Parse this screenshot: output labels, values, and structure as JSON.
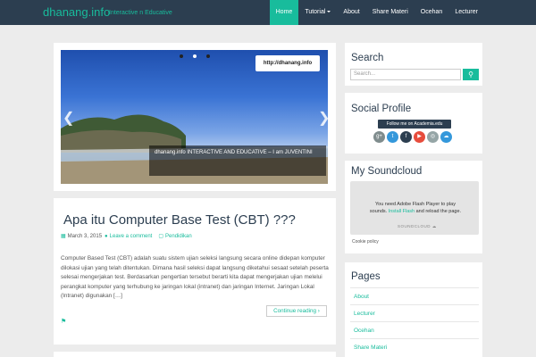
{
  "header": {
    "brand": "dhanang.info",
    "tagline": "Interactive n Educative",
    "nav": [
      {
        "label": "Home",
        "active": true
      },
      {
        "label": "Tutorial",
        "dropdown": true
      },
      {
        "label": "About"
      },
      {
        "label": "Share Materi"
      },
      {
        "label": "Ocehan"
      },
      {
        "label": "Lecturer"
      }
    ]
  },
  "slider": {
    "url_label": "http://dhanang.info",
    "caption": "dhanang.info INTERACTIVE AND EDUCATIVE – I am JUVENTINI",
    "prev_icon": "chevron-left-icon",
    "next_icon": "chevron-right-icon",
    "dots": [
      false,
      true,
      false
    ]
  },
  "post": {
    "title": "Apa itu Computer Base Test (CBT) ???",
    "date": "March 3, 2015",
    "comments": "Leave a comment",
    "category": "Pendidikan",
    "excerpt": "Computer Based Test (CBT) adalah suatu sistem ujian seleksi langsung secara online didepan komputer dilokasi ujian yang telah ditentukan. Dimana hasil seleksi dapat langsung diketahui sesaat setelah peserta selesai mengerjakan test. Berdasarkan pengertian tersebut berarti kita dapat mengerjakan ujian melelui perangkat komputer yang terhubung ke jaringan lokal (intranet) dan jaringan Internet. Jaringan Lokal (Intranet) digunakan […]",
    "continue": "Continue reading"
  },
  "sidebar": {
    "search": {
      "title": "Search",
      "placeholder": "Search..."
    },
    "social": {
      "title": "Social Profile",
      "academia": "Follow me on Academia.edu",
      "icons": [
        {
          "name": "google-plus-icon",
          "color": "#7f8c8d",
          "glyph": "g+"
        },
        {
          "name": "twitter-icon",
          "color": "#3498db",
          "glyph": "t"
        },
        {
          "name": "facebook-icon",
          "color": "#2c3e50",
          "glyph": "f"
        },
        {
          "name": "youtube-icon",
          "color": "#e74c3c",
          "glyph": "▶"
        },
        {
          "name": "instagram-icon",
          "color": "#95a5a6",
          "glyph": "◎"
        },
        {
          "name": "soundcloud-icon",
          "color": "#3498db",
          "glyph": "☁"
        }
      ]
    },
    "soundcloud": {
      "title": "My Soundcloud",
      "line1": "You need Adobe Flash Player to play sounds.",
      "install": "Install Flash",
      "line2": "and reload the page.",
      "logo": "SOUNDCLOUD",
      "cookie": "Cookie policy"
    },
    "pages": {
      "title": "Pages",
      "items": [
        "About",
        "Lecturer",
        "Ocehan",
        "Share Materi"
      ]
    }
  },
  "colors": {
    "accent": "#18bc9c",
    "navbar": "#2c3e50"
  }
}
